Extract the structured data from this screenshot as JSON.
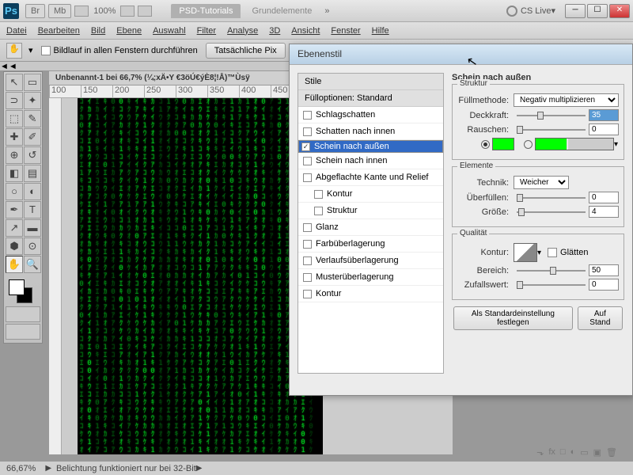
{
  "titlebar": {
    "zoom": "100%",
    "tab1": "PSD-Tutorials",
    "tab2": "Grundelemente",
    "cslive": "CS Live"
  },
  "menu": [
    "Datei",
    "Bearbeiten",
    "Bild",
    "Ebene",
    "Auswahl",
    "Filter",
    "Analyse",
    "3D",
    "Ansicht",
    "Fenster",
    "Hilfe"
  ],
  "optbar": {
    "scroll_all": "Bildlauf in allen Fenstern durchführen",
    "actual": "Tatsächliche Pix"
  },
  "doc": {
    "title": "Unbenannt-1 bei 66,7% (¼;xÄ•Y €3öÚ€ýÈ8¦!Å)™Ùsÿ",
    "ruler": [
      "100",
      "150",
      "200",
      "250",
      "300",
      "350",
      "400",
      "450"
    ]
  },
  "dialog": {
    "title": "Ebenenstil",
    "stile": "Stile",
    "fuell": "Füllоptionen: Standard",
    "items": [
      {
        "l": "Schlagschatten",
        "c": false
      },
      {
        "l": "Schatten nach innen",
        "c": false
      },
      {
        "l": "Schein nach außen",
        "c": true,
        "sel": true
      },
      {
        "l": "Schein nach innen",
        "c": false
      },
      {
        "l": "Abgeflachte Kante und Relief",
        "c": false
      },
      {
        "l": "Kontur",
        "c": false,
        "sub": true
      },
      {
        "l": "Struktur",
        "c": false,
        "sub": true
      },
      {
        "l": "Glanz",
        "c": false
      },
      {
        "l": "Farbüberlagerung",
        "c": false
      },
      {
        "l": "Verlaufsüberlagerung",
        "c": false
      },
      {
        "l": "Musterüberlagerung",
        "c": false
      },
      {
        "l": "Kontur",
        "c": false
      }
    ],
    "heading": "Schein nach außen",
    "struktur": {
      "title": "Struktur",
      "fuellmethode": "Füllmethode:",
      "fuell_val": "Negativ multiplizieren",
      "deckkraft": "Deckkraft:",
      "deck_val": "35",
      "rauschen": "Rauschen:",
      "rausch_val": "0"
    },
    "elemente": {
      "title": "Elemente",
      "technik": "Technik:",
      "technik_val": "Weicher",
      "ueberfuellen": "Überfüllen:",
      "ueber_val": "0",
      "groesse": "Größe:",
      "groesse_val": "4"
    },
    "qualitaet": {
      "title": "Qualität",
      "kontur": "Kontur:",
      "glaetten": "Glätten",
      "bereich": "Bereich:",
      "bereich_val": "50",
      "zufall": "Zufallswert:",
      "zufall_val": "0"
    },
    "btn_default": "Als Standardeinstellung festlegen",
    "btn_reset": "Auf Stand"
  },
  "status": {
    "zoom": "66,67%",
    "msg": "Belichtung funktioniert nur bei 32-Bit"
  }
}
